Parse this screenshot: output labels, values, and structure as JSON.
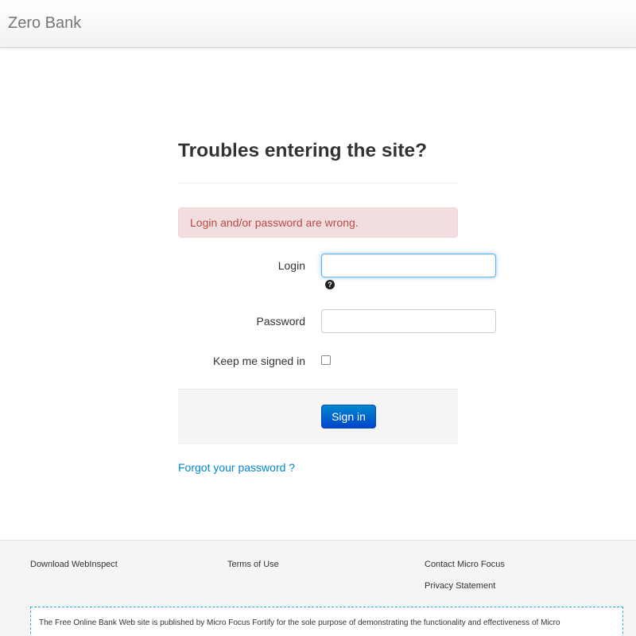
{
  "brand": "Zero Bank",
  "title": "Troubles entering the site?",
  "alert": "Login and/or password are wrong.",
  "form": {
    "login_label": "Login",
    "login_value": "",
    "password_label": "Password",
    "password_value": "",
    "remember_label": "Keep me signed in",
    "remember_checked": false,
    "help_glyph": "?",
    "submit_label": "Sign in"
  },
  "forgot_link": "Forgot your password ?",
  "footer": {
    "links": {
      "download": "Download WebInspect",
      "terms": "Terms of Use",
      "contact": "Contact Micro Focus",
      "privacy": "Privacy Statement"
    },
    "disclaimer": "The Free Online Bank Web site is published by Micro Focus Fortify for the sole purpose of demonstrating the functionality and effectiveness of Micro"
  },
  "colors": {
    "accent": "#0088cc",
    "alert_bg": "#f2dede",
    "alert_text": "#b94a48",
    "button": "#0055cc"
  }
}
